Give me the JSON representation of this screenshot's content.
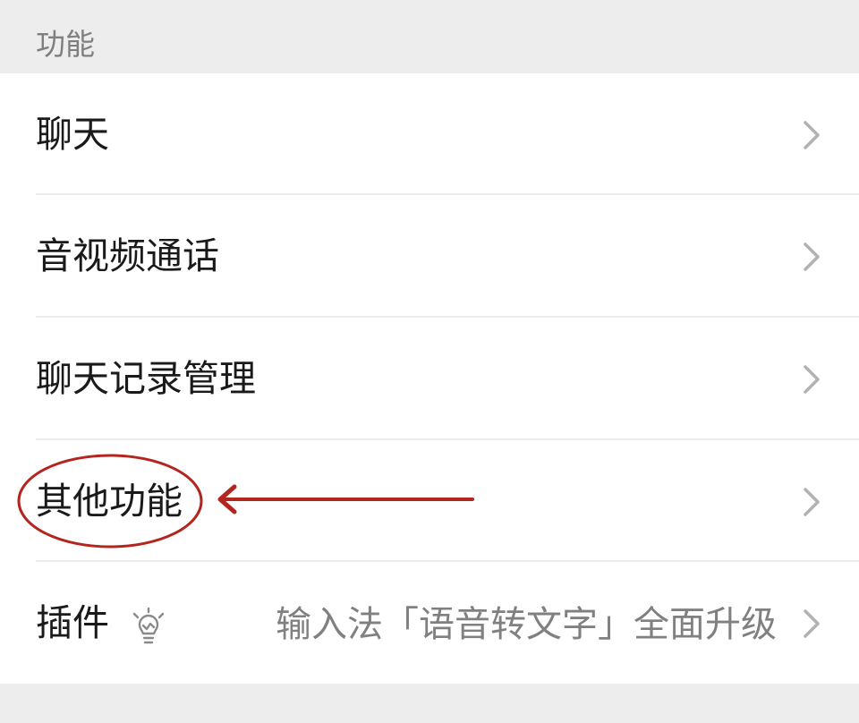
{
  "section": {
    "title": "功能"
  },
  "rows": [
    {
      "label": "聊天"
    },
    {
      "label": "音视频通话"
    },
    {
      "label": "聊天记录管理"
    },
    {
      "label": "其他功能"
    },
    {
      "label": "插件",
      "hint": "输入法「语音转文字」全面升级"
    }
  ],
  "colors": {
    "annotation": "#b3261e",
    "chevron": "#b2b2b2",
    "background": "#ededed"
  },
  "icons": {
    "chevron": "chevron-right-icon",
    "plugin": "lightbulb-icon"
  }
}
